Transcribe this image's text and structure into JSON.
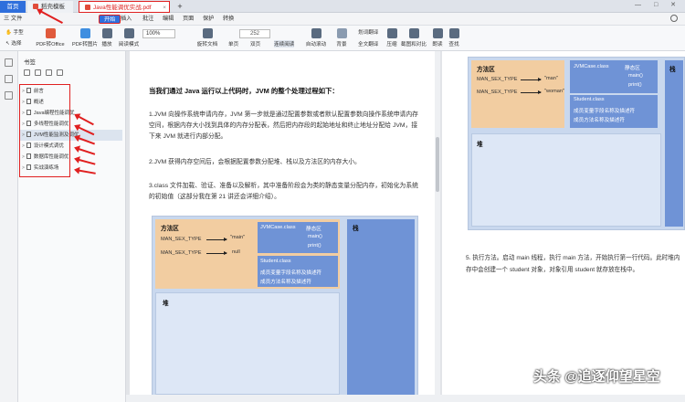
{
  "tabs": [
    {
      "label": "首页"
    },
    {
      "label": "稻壳模板"
    },
    {
      "label": "Java性能调优实战.pdf"
    }
  ],
  "menu": {
    "file": "三 文件",
    "start": "开始",
    "items": [
      "插入",
      "批注",
      "编辑",
      "页面",
      "保护",
      "转换"
    ]
  },
  "toolbar": {
    "hand": "手型",
    "select": "选择",
    "pdf_to_office": "PDF转Office",
    "pdf_to_image": "PDF转图片",
    "play": "播放",
    "read_mode": "阅读模式",
    "zoom": "100%",
    "rotate": "旋转文档",
    "single": "单页",
    "double": "双页",
    "continuous": "连续阅读",
    "auto_scroll": "自动滚动",
    "background": "背景",
    "translate_line": "划词翻译",
    "full_translate": "全文翻译",
    "compress": "压缩",
    "screenshot_compare": "截图和对比",
    "read_aloud": "朗读",
    "find": "查找",
    "page": "252"
  },
  "sidebar": {
    "title": "书签",
    "items": [
      {
        "label": "前言"
      },
      {
        "label": "概述"
      },
      {
        "label": "Java编程性能调优"
      },
      {
        "label": "多线程性能调优"
      },
      {
        "label": "JVM性能监测及调优"
      },
      {
        "label": "设计模式调优"
      },
      {
        "label": "数据库性能调优"
      },
      {
        "label": "实战演练场"
      }
    ]
  },
  "page1": {
    "heading": "当我们通过 Java 运行以上代码时，JVM 的整个处理过程如下：",
    "p1": "1.JVM 向操作系统申请内存，JVM 第一步就是通过配置参数或者默认配置参数向操作系统申请内存空间，根据内存大小找到具体的内存分配表，然后把内存段的起始地址和终止地址分配给 JVM，接下来 JVM 就进行内部分配。",
    "p2": "2.JVM 获得内存空间后，会根据配置参数分配堆、栈以及方法区的内存大小。",
    "p3": "3.class 文件加载、验证、准备以及解析，其中准备阶段会为类的静态变量分配内存，初始化为系统的初始值（这部分我在第 21 讲还会详细介绍）。"
  },
  "diagram1": {
    "method_area": "方法区",
    "var1": "MAN_SEX_TYPE",
    "val1": "\"main\"",
    "var2": "MAN_SEX_TYPE",
    "val2": "null",
    "jvmcase": "JVMCase.class",
    "static_area": "静态区",
    "m1": "main()",
    "m2": "print()",
    "student": "Student.class",
    "s1": "成员变量字段名称及描述符",
    "s2": "成员方法名称及描述符",
    "heap": "堆",
    "stack": "栈"
  },
  "diagram2": {
    "method_area": "方法区",
    "var1": "MAN_SEX_TYPE",
    "val1": "\"man\"",
    "var2": "MAN_SEX_TYPE",
    "val2": "\"woman\"",
    "jvmcase": "JVMCase.class",
    "static_area": "静态区",
    "m1": "main()",
    "m2": "print()",
    "student": "Student.class",
    "s1": "成员变量字段名称及描述符",
    "s2": "成员方法名称及描述符",
    "heap": "堆",
    "stack": "栈"
  },
  "page2": {
    "step5": "5. 执行方法。启动 main 线程，执行 main 方法，开始执行第一行代码。此时堆内存中会创建一个 student 对象，对象引用 student 就存放在栈中。"
  },
  "watermark": "头条 @追逐仰望星空"
}
